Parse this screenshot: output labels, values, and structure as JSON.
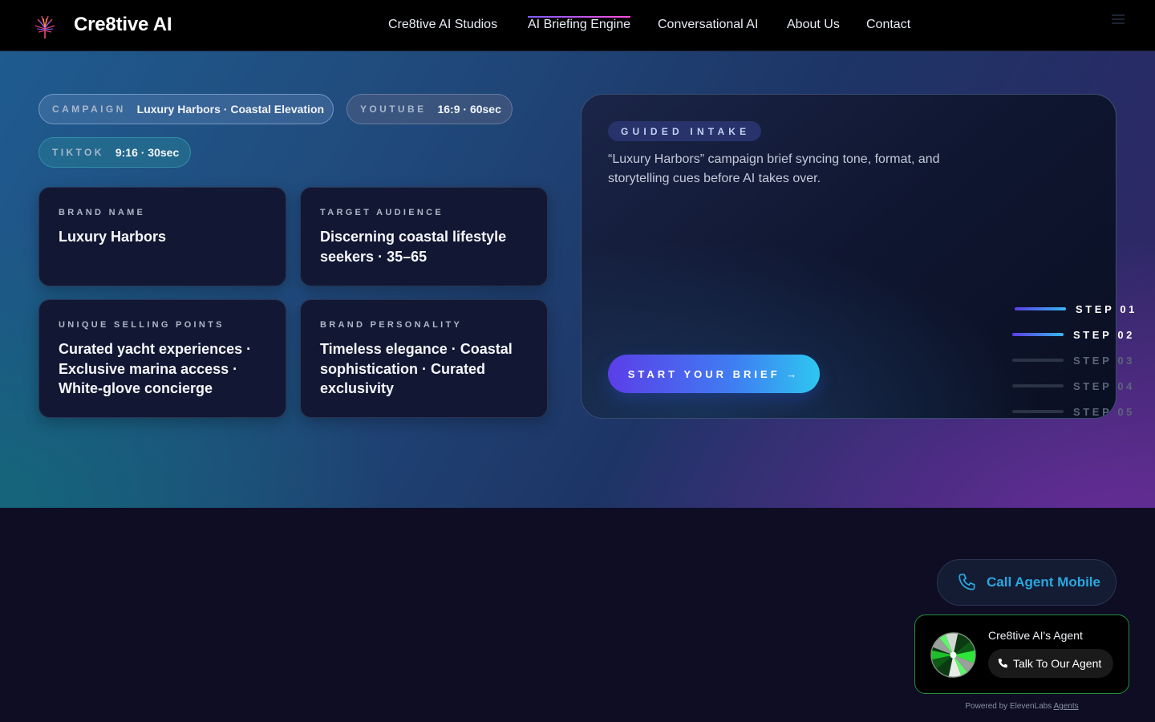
{
  "nav": {
    "logo_text": "Cre8tive AI",
    "links": [
      {
        "label": "Cre8tive AI Studios"
      },
      {
        "label": "AI Briefing Engine"
      },
      {
        "label": "Conversational AI"
      },
      {
        "label": "About Us"
      },
      {
        "label": "Contact"
      }
    ],
    "active_link": "AI Briefing Engine"
  },
  "pills": {
    "campaign": {
      "key": "CAMPAIGN",
      "value": "Luxury Harbors · Coastal Elevation"
    },
    "youtube": {
      "key": "YOUTUBE",
      "value": "16:9 · 60sec"
    },
    "tiktok": {
      "key": "TIKTOK",
      "value": "9:16 · 30sec"
    }
  },
  "cards": {
    "brand_name": {
      "key": "BRAND NAME",
      "value": "Luxury Harbors"
    },
    "target_audience": {
      "key": "TARGET AUDIENCE",
      "value": "Discerning coastal lifestyle seekers · 35–65"
    },
    "unique_selling_points": {
      "key": "UNIQUE SELLING POINTS",
      "value": "Curated yacht experiences · Exclusive marina access · White-glove concierge"
    },
    "brand_personality": {
      "key": "BRAND PERSONALITY",
      "value": "Timeless elegance · Coastal sophistication · Curated exclusivity"
    }
  },
  "intake": {
    "tag": "GUIDED INTAKE",
    "description": "“Luxury Harbors” campaign brief syncing tone, format, and storytelling cues before AI takes over.",
    "start_button": "START YOUR BRIEF →",
    "steps": [
      {
        "label": "STEP 01",
        "state": "complete"
      },
      {
        "label": "STEP 02",
        "state": "complete"
      },
      {
        "label": "STEP 03",
        "state": "pending"
      },
      {
        "label": "STEP 04",
        "state": "pending"
      },
      {
        "label": "STEP 05",
        "state": "pending"
      }
    ]
  },
  "call_mobile": {
    "label": "Call Agent Mobile"
  },
  "agent_widget": {
    "name": "Cre8tive AI's Agent",
    "button": "Talk To Our Agent",
    "powered_prefix": "Powered by ElevenLabs",
    "powered_link": "Agents"
  },
  "icons": {
    "logo": "tree-logo-icon",
    "menu": "hamburger-menu-icon",
    "phone": "phone-icon",
    "avatar": "agent-orb-avatar"
  },
  "colors": {
    "accent_purple": "#5b3ee8",
    "accent_cyan": "#2ec7f0",
    "call_blue": "#2aa7e0",
    "widget_border": "#1f8f3a",
    "page_bg": "#0e0d24"
  }
}
